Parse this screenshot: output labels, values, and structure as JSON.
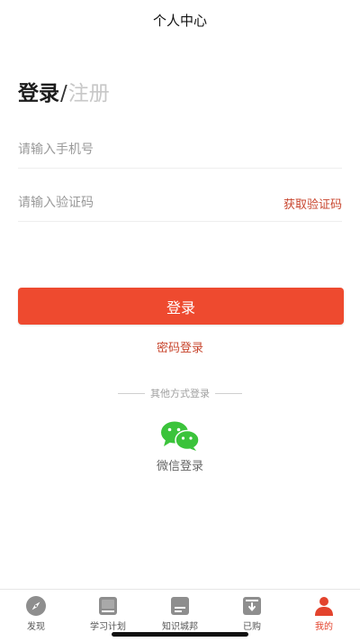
{
  "header": {
    "title": "个人中心"
  },
  "mode_tabs": {
    "login": "登录",
    "separator": "/",
    "register": "注册"
  },
  "form": {
    "phone": {
      "placeholder": "请输入手机号",
      "value": ""
    },
    "code": {
      "placeholder": "请输入验证码",
      "value": "",
      "action": "获取验证码"
    }
  },
  "login_button": "登录",
  "password_login": "密码登录",
  "other_methods": "其他方式登录",
  "wechat": {
    "label": "微信登录",
    "icon": "wechat-icon"
  },
  "tabbar": [
    {
      "label": "发现",
      "icon": "compass-icon",
      "active": false
    },
    {
      "label": "学习计划",
      "icon": "book-icon",
      "active": false
    },
    {
      "label": "知识城邦",
      "icon": "document-icon",
      "active": false
    },
    {
      "label": "已购",
      "icon": "download-box-icon",
      "active": false
    },
    {
      "label": "我的",
      "icon": "person-icon",
      "active": true
    }
  ],
  "colors": {
    "accent": "#ee4a2f",
    "link": "#c8452d",
    "wechat": "#3bc33b",
    "icon_gray": "#8e8e8e"
  }
}
